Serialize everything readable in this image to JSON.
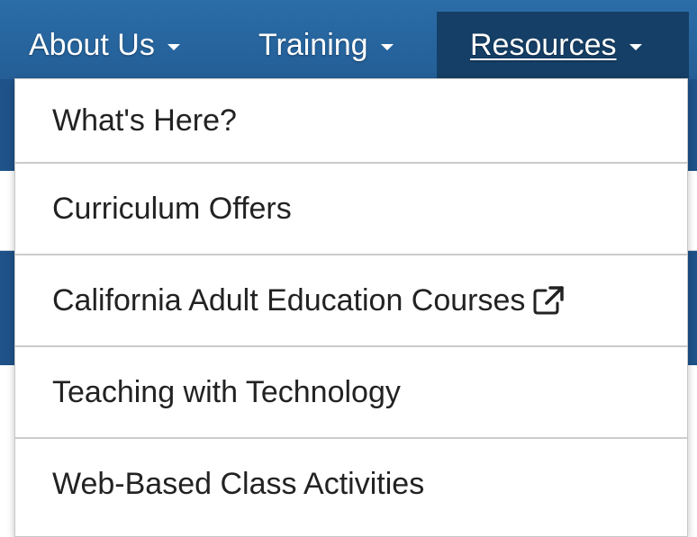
{
  "nav": {
    "items": [
      {
        "label": "About Us"
      },
      {
        "label": "Training"
      },
      {
        "label": "Resources"
      }
    ]
  },
  "dropdown": {
    "items": [
      {
        "label": "What's Here?"
      },
      {
        "label": "Curriculum Offers"
      },
      {
        "label": "California Adult Education Courses",
        "icon": "external-link-icon"
      },
      {
        "label": "Teaching with Technology"
      },
      {
        "label": "Web-Based Class Activities"
      }
    ]
  },
  "colors": {
    "navbar": "#2b6da8",
    "active_tab": "#153f66",
    "banner": "#1e5289",
    "dropdown_text": "#222222"
  }
}
